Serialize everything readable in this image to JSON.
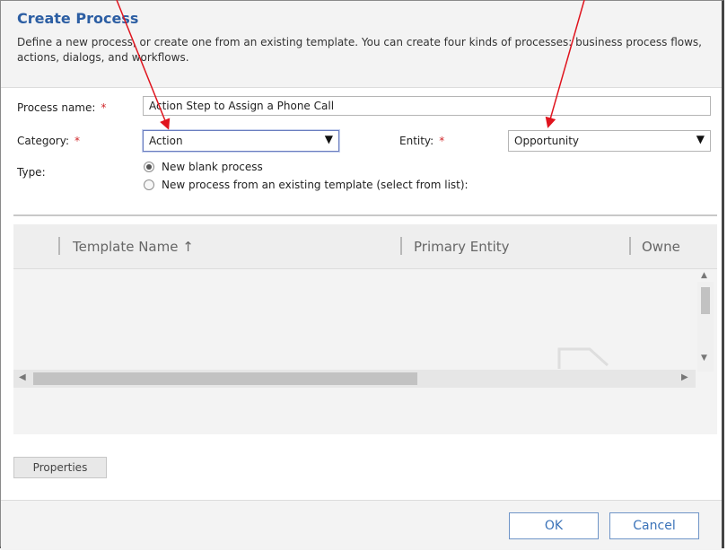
{
  "dialog": {
    "title": "Create Process",
    "description": "Define a new process, or create one from an existing template. You can create four kinds of processes: business process flows, actions, dialogs, and workflows."
  },
  "form": {
    "process_name_label": "Process name:",
    "process_name_value": "Action Step to Assign a Phone Call",
    "category_label": "Category:",
    "category_value": "Action",
    "entity_label": "Entity:",
    "entity_value": "Opportunity",
    "type_label": "Type:",
    "required_marker": "*",
    "type_options": [
      {
        "label": "New blank process",
        "selected": true
      },
      {
        "label": "New process from an existing template (select from list):",
        "selected": false
      }
    ]
  },
  "grid": {
    "columns": [
      "Template Name ↑",
      "Primary Entity",
      "Owne"
    ]
  },
  "buttons": {
    "properties": "Properties",
    "ok": "OK",
    "cancel": "Cancel"
  },
  "colors": {
    "annotation_arrow": "#e0141e",
    "title": "#2c5ea3",
    "required": "#d0272a"
  },
  "icons": {
    "dropdown": "▼",
    "sort": "↑",
    "scroll_up": "▲",
    "scroll_down": "▼",
    "scroll_left": "◀",
    "scroll_right": "▶"
  }
}
